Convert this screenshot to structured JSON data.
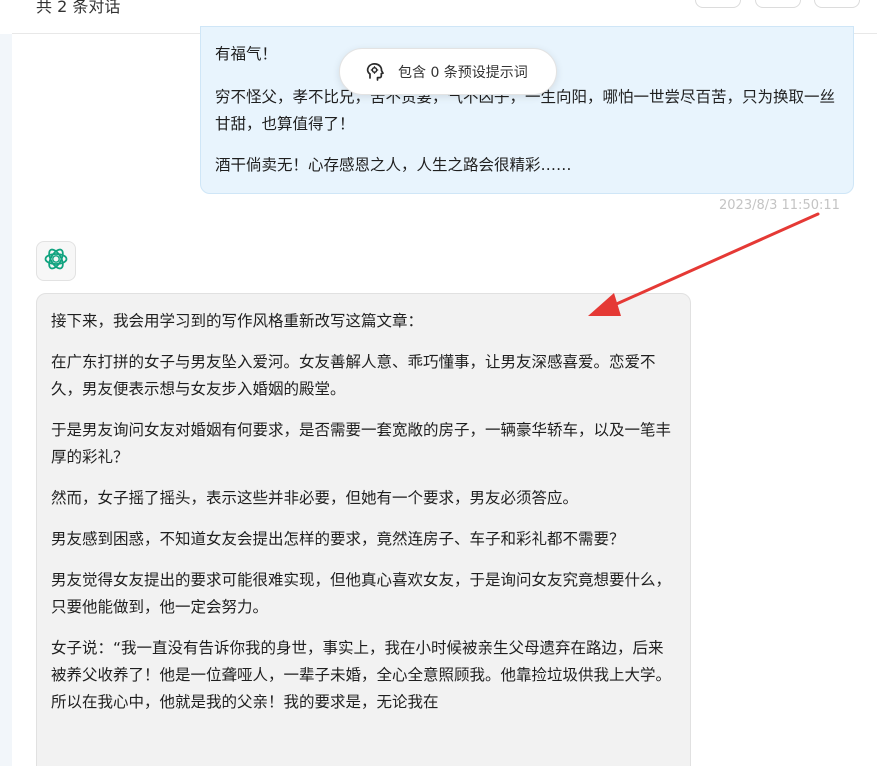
{
  "header": {
    "title": "共 2 条对话"
  },
  "prompt_pill": {
    "label": "包含 0 条预设提示词",
    "icon": "brain-icon"
  },
  "user_message": {
    "paragraphs": [
      "有福气！",
      "穷不怪父，孝不比兄，苦不责妻，气不凶子，一生向阳，哪怕一世尝尽百苦，只为换取一丝甘甜，也算值得了！",
      "酒干倘卖无！心存感恩之人，人生之路会很精彩……"
    ],
    "timestamp": "2023/8/3 11:50:11"
  },
  "bot_message": {
    "avatar_icon": "openai-logo-icon",
    "paragraphs": [
      "接下来，我会用学习到的写作风格重新改写这篇文章：",
      "在广东打拼的女子与男友坠入爱河。女友善解人意、乖巧懂事，让男友深感喜爱。恋爱不久，男友便表示想与女友步入婚姻的殿堂。",
      "于是男友询问女友对婚姻有何要求，是否需要一套宽敞的房子，一辆豪华轿车，以及一笔丰厚的彩礼？",
      "然而，女子摇了摇头，表示这些并非必要，但她有一个要求，男友必须答应。",
      "男友感到困惑，不知道女友会提出怎样的要求，竟然连房子、车子和彩礼都不需要？",
      "男友觉得女友提出的要求可能很难实现，但他真心喜欢女友，于是询问女友究竟想要什么，只要他能做到，他一定会努力。",
      "女子说：“我一直没有告诉你我的身世，事实上，我在小时候被亲生父母遗弃在路边，后来被养父收养了！他是一位聋哑人，一辈子未婚，全心全意照顾我。他靠捡垃圾供我上大学。所以在我心中，他就是我的父亲！我的要求是，无论我在"
    ]
  },
  "annotation": {
    "arrow_color": "#e53935"
  }
}
